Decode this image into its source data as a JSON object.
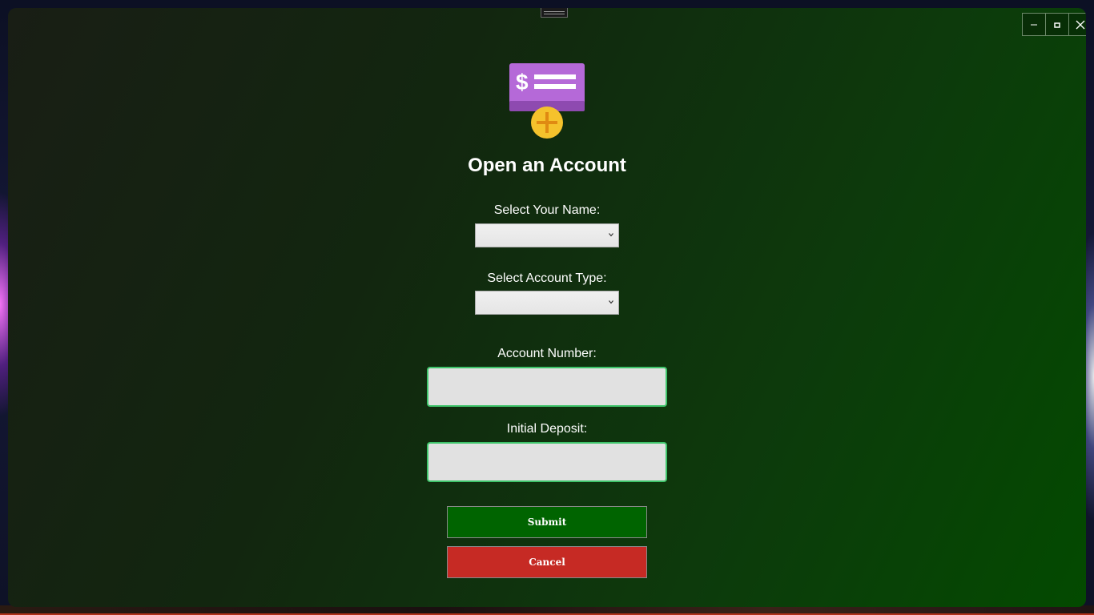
{
  "window": {
    "controls": {
      "minimize_icon": "minimize-icon",
      "maximize_icon": "maximize-icon",
      "close_icon": "close-icon"
    }
  },
  "form": {
    "icon": "new-account-check-icon",
    "title": "Open an Account",
    "name_label": "Select Your Name:",
    "name_value": "",
    "account_type_label": "Select Account Type:",
    "account_type_value": "",
    "account_number_label": "Account Number:",
    "account_number_value": "",
    "initial_deposit_label": "Initial Deposit:",
    "initial_deposit_value": "",
    "submit_label": "Submit",
    "cancel_label": "Cancel"
  },
  "colors": {
    "window_gradient_start": "#191e15",
    "window_gradient_end": "#034a00",
    "textbox_border": "#3ec46a",
    "submit_bg": "#006400",
    "cancel_bg": "#c62a24",
    "icon_purple": "#b569d8",
    "icon_yellow": "#f5c22c"
  }
}
